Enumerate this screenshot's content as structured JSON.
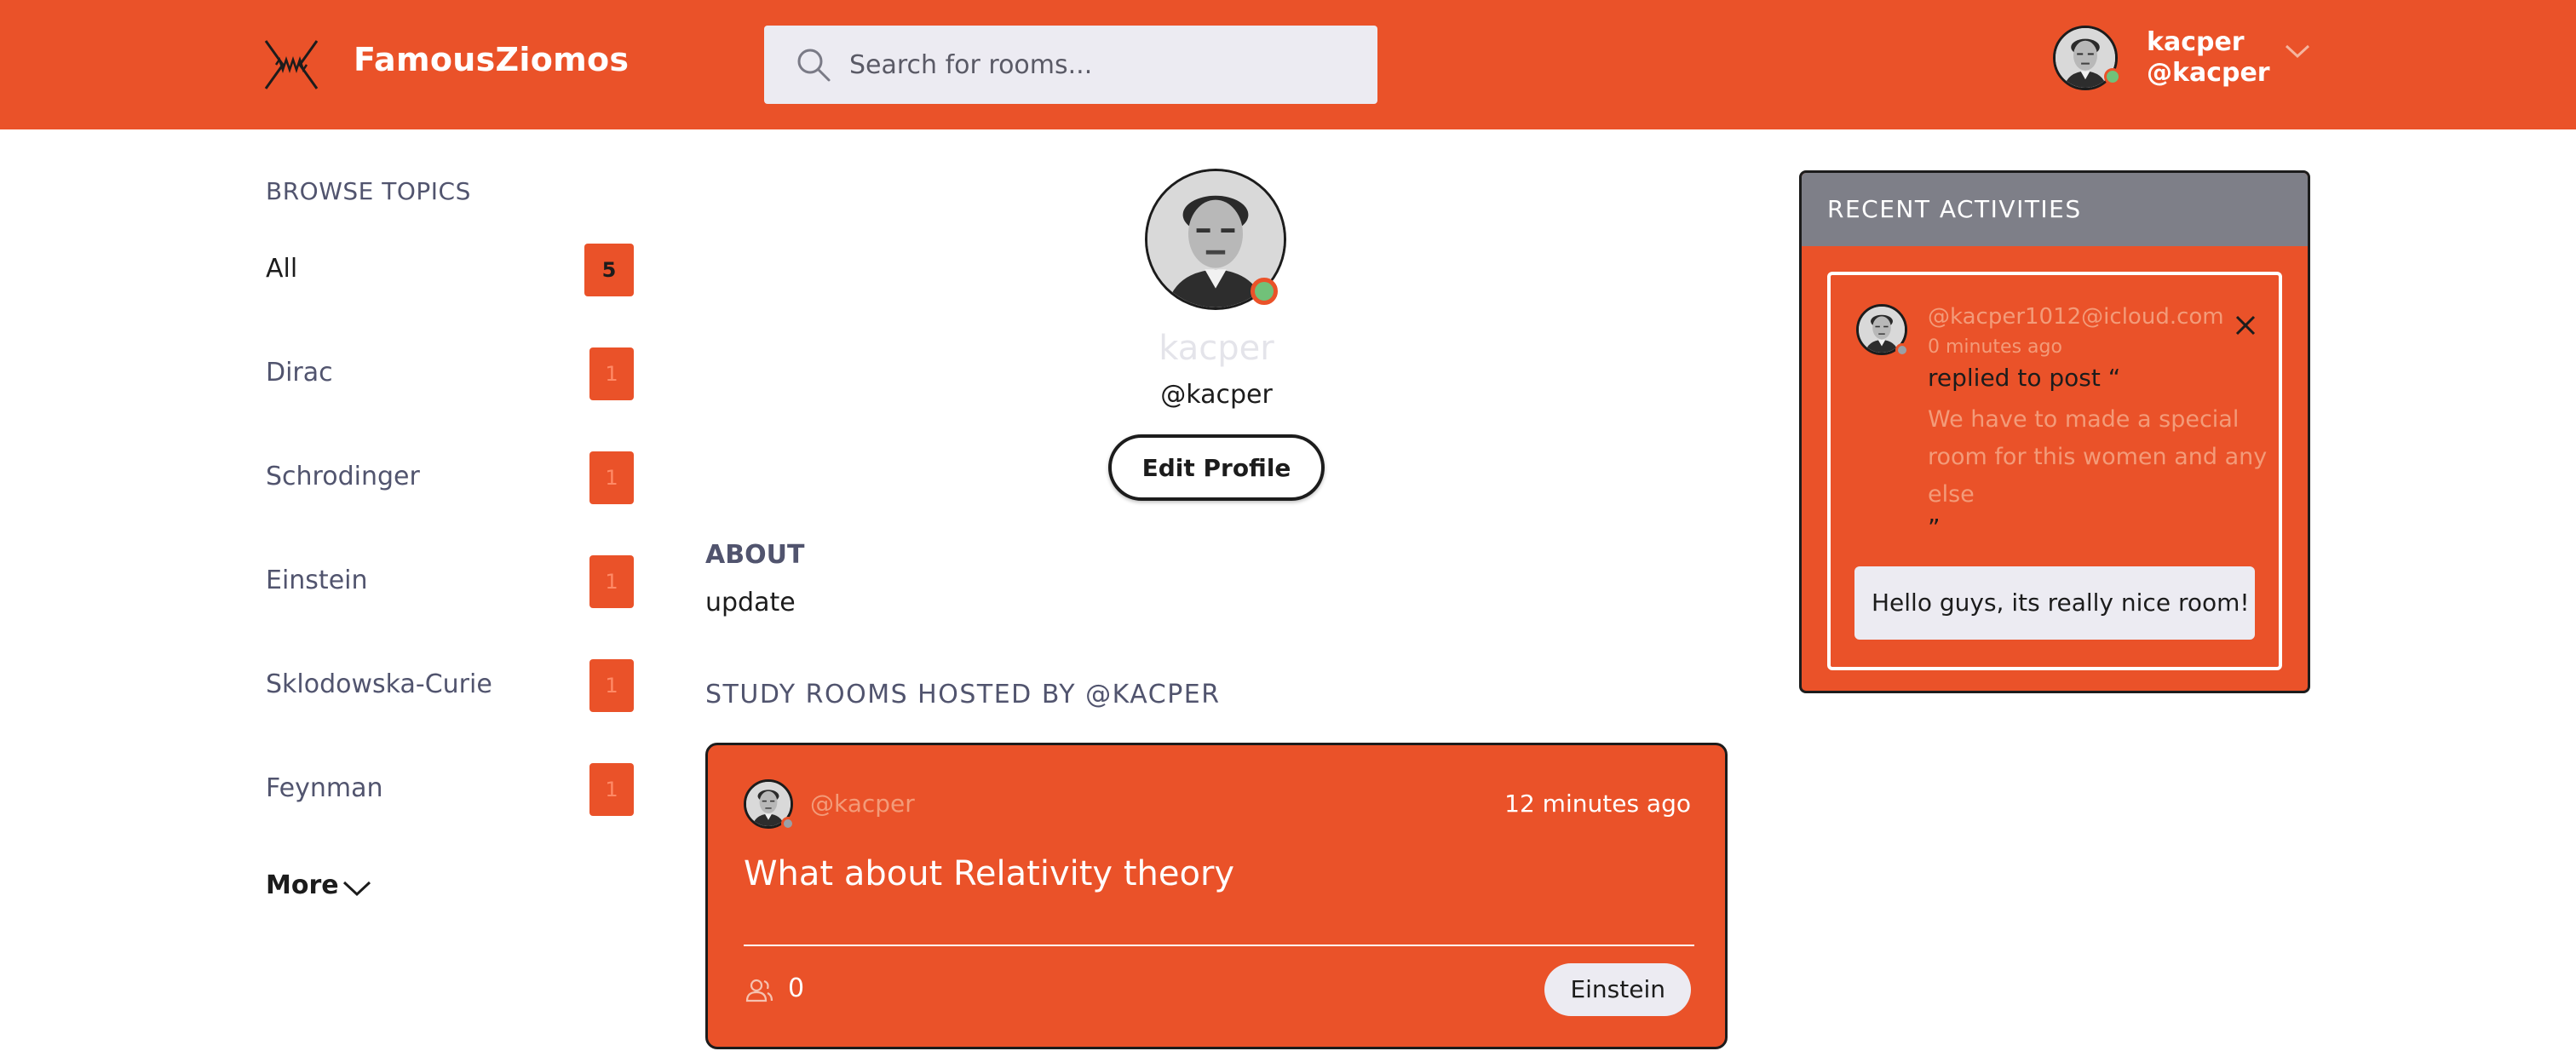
{
  "header": {
    "brand": "FamousZiomos",
    "search_placeholder": "Search for rooms...",
    "user": {
      "name": "kacper",
      "handle": "@kacper"
    }
  },
  "sidebar": {
    "title": "BROWSE TOPICS",
    "topics": [
      {
        "label": "All",
        "count": "5"
      },
      {
        "label": "Dirac",
        "count": "1"
      },
      {
        "label": "Schrodinger",
        "count": "1"
      },
      {
        "label": "Einstein",
        "count": "1"
      },
      {
        "label": "Sklodowska-Curie",
        "count": "1"
      },
      {
        "label": "Feynman",
        "count": "1"
      }
    ],
    "more_label": "More"
  },
  "profile": {
    "name": "kacper",
    "handle": "@kacper",
    "edit_label": "Edit Profile",
    "about_title": "ABOUT",
    "about_text": "update",
    "rooms_title": "STUDY ROOMS HOSTED BY @KACPER"
  },
  "rooms": [
    {
      "host": "@kacper",
      "time": "12 minutes ago",
      "title": "What about Relativity theory",
      "participants": "0",
      "topic": "Einstein"
    }
  ],
  "activities": {
    "title": "RECENT ACTIVITIES",
    "items": [
      {
        "user": "@kacper1012@icloud.com",
        "time": "0 minutes ago",
        "action": "replied to post “",
        "quote": "We have to made a special room for this women and any else",
        "quote_end": "”",
        "message": "Hello guys, its really nice room!"
      }
    ]
  },
  "colors": {
    "accent": "#EA5229",
    "panel_header": "#7E7F88",
    "input_bg": "#ECEBF2",
    "muted_text": "#51546E",
    "online": "#71C179"
  },
  "icons": {
    "logo": "tesla-coil-logo-icon",
    "search": "search-icon",
    "dropdown": "chevron-down-icon",
    "participants": "users-icon",
    "close": "close-icon"
  }
}
